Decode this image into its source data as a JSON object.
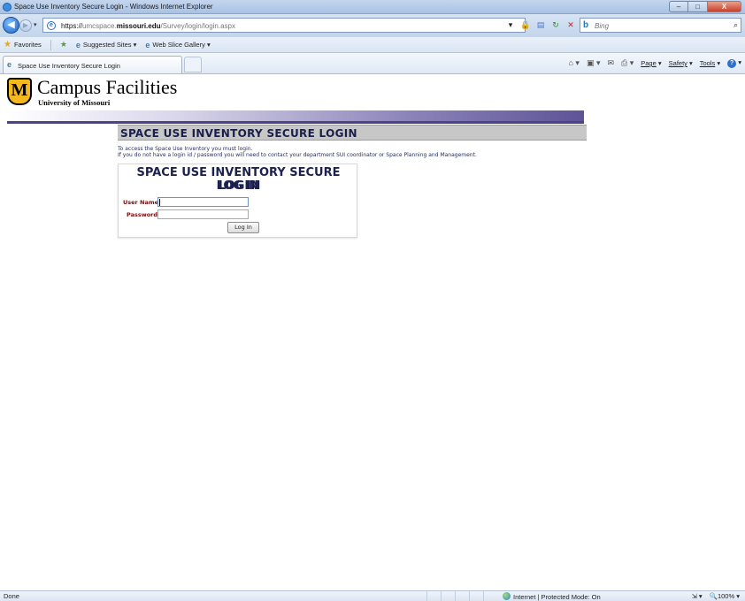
{
  "window": {
    "title": "Space Use Inventory Secure Login - Windows Internet Explorer",
    "buttons": {
      "minimize": "–",
      "maximize": "□",
      "close": "X"
    }
  },
  "address_bar": {
    "protocol": "https://",
    "host_prefix": "umcspace.",
    "host_main": "missouri.edu",
    "path": "/Survey/login/login.aspx",
    "search_placeholder": "Bing"
  },
  "favorites_bar": {
    "favorites_label": "Favorites",
    "items": [
      {
        "label": "Suggested Sites ▾",
        "icon": "ie-icon"
      },
      {
        "label": "Web Slice Gallery ▾",
        "icon": "ie-icon"
      }
    ]
  },
  "tab": {
    "label": "Space Use Inventory Secure Login"
  },
  "command_bar": {
    "page": "Page",
    "safety": "Safety",
    "tools": "Tools"
  },
  "site": {
    "logo_letters": "M",
    "name": "Campus Facilities",
    "subname": "University of Missouri"
  },
  "section": {
    "heading": "SPACE USE INVENTORY SECURE LOGIN",
    "intro_line1": "To access the Space Use Inventory you must login.",
    "intro_line2": "If you do not have a login id / password you will need to contact your department SUI coordinator or Space Planning and Management."
  },
  "login": {
    "title_line1": "SPACE USE INVENTORY SECURE LOGIN",
    "title_line2": "LOG IN",
    "username_label": "User Name:",
    "username_value": "",
    "password_label": "Password:",
    "password_value": "",
    "button_label": "Log In"
  },
  "status_bar": {
    "status": "Done",
    "zone": "Internet | Protected Mode: On",
    "zoom": "100%"
  }
}
